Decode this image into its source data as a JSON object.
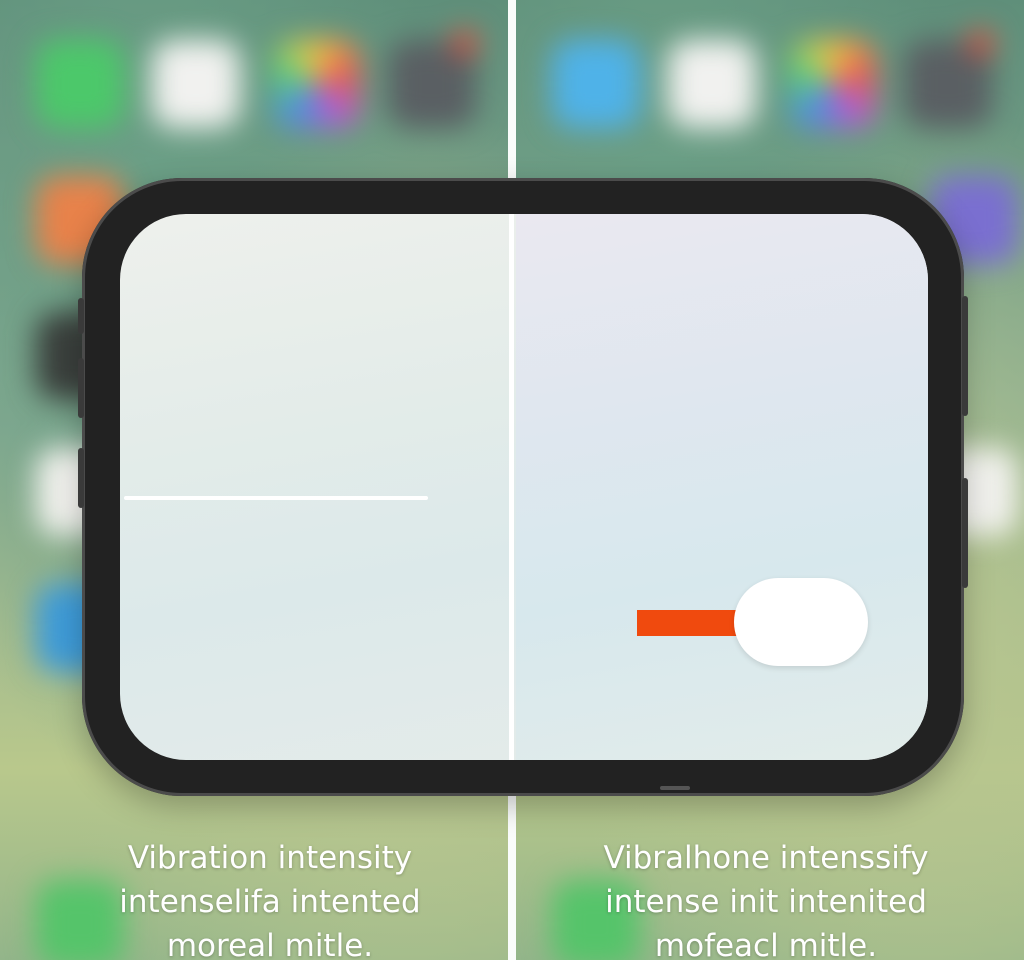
{
  "colors": {
    "toggle_accent": "#f04a0e",
    "toggle_knob": "#ffffff",
    "divider": "#ffffff",
    "caption_text": "#ffffff"
  },
  "background_apps": {
    "left": [
      "messages-app-icon",
      "blank-app-icon",
      "photos-app-icon",
      "camera-app-icon",
      "orange-app-icon",
      "dark-app-icon",
      "white-app-icon",
      "blue-app-icon",
      "phone-app-icon"
    ],
    "right": [
      "facetime-app-icon",
      "blank-app-icon",
      "photos-app-icon",
      "camera-app-icon",
      "purple-app-icon",
      "white-app-icon",
      "phone-app-icon"
    ]
  },
  "toggle": {
    "state": "on"
  },
  "captions": {
    "left": {
      "line1": "Vibration intensity",
      "line2": "intenselifa intented",
      "line3": "moreal mitle."
    },
    "right": {
      "line1": "Vibralhone intenssify",
      "line2": "intense init intenited",
      "line3": "mofeacl mitle."
    }
  }
}
